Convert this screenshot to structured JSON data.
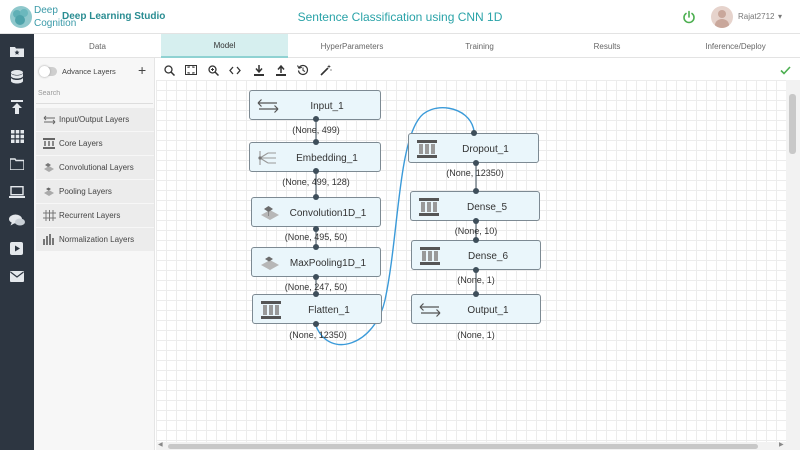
{
  "header": {
    "logo_line1": "Deep",
    "logo_line2": "Cognition",
    "brand": "Deep Learning Studio",
    "title": "Sentence Classification using CNN 1D",
    "user": "Rajat2712",
    "user_caret": "▾"
  },
  "iconbar": [
    "folder-star-icon",
    "database-icon",
    "upload-icon",
    "grid-icon",
    "folder-icon",
    "laptop-icon",
    "chat-icon",
    "play-icon",
    "mail-icon"
  ],
  "tabs": [
    {
      "label": "Data"
    },
    {
      "label": "Model"
    },
    {
      "label": "HyperParameters"
    },
    {
      "label": "Training"
    },
    {
      "label": "Results"
    },
    {
      "label": "Inference/Deploy"
    }
  ],
  "active_tab": "Model",
  "panel": {
    "advance_label": "Advance Layers",
    "plus": "+",
    "search_placeholder": "Search",
    "categories": [
      {
        "label": "Input/Output Layers"
      },
      {
        "label": "Core Layers"
      },
      {
        "label": "Convolutional Layers"
      },
      {
        "label": "Pooling Layers"
      },
      {
        "label": "Recurrent Layers"
      },
      {
        "label": "Normalization Layers"
      }
    ]
  },
  "toolbar": [
    "zoom-search-icon",
    "fit-screen-icon",
    "zoom-in-icon",
    "code-icon",
    "download-icon",
    "upload-icon",
    "history-icon",
    "magic-wand-icon"
  ],
  "model": {
    "nodes": [
      {
        "label": "Input_1",
        "output": "(None, 499)",
        "icon": "arrows-icon"
      },
      {
        "label": "Embedding_1",
        "output": "(None, 499, 128)",
        "icon": "embedding-icon"
      },
      {
        "label": "Convolution1D_1",
        "output": "(None, 495, 50)",
        "icon": "convolution-icon"
      },
      {
        "label": "MaxPooling1D_1",
        "output": "(None, 247, 50)",
        "icon": "pooling-icon"
      },
      {
        "label": "Flatten_1",
        "output": "(None, 12350)",
        "icon": "dense-icon"
      },
      {
        "label": "Dropout_1",
        "output": "(None, 12350)",
        "icon": "dense-icon"
      },
      {
        "label": "Dense_5",
        "output": "(None, 10)",
        "icon": "dense-icon"
      },
      {
        "label": "Dense_6",
        "output": "(None, 1)",
        "icon": "dense-icon"
      },
      {
        "label": "Output_1",
        "output": "(None, 1)",
        "icon": "arrows-icon"
      }
    ]
  },
  "colors": {
    "accent": "#2aa3a8",
    "iconbar": "#2d3641",
    "node_fill": "#eaf6fb",
    "link": "#3a9ad9",
    "power": "#4caf50",
    "check": "#4caf50"
  }
}
